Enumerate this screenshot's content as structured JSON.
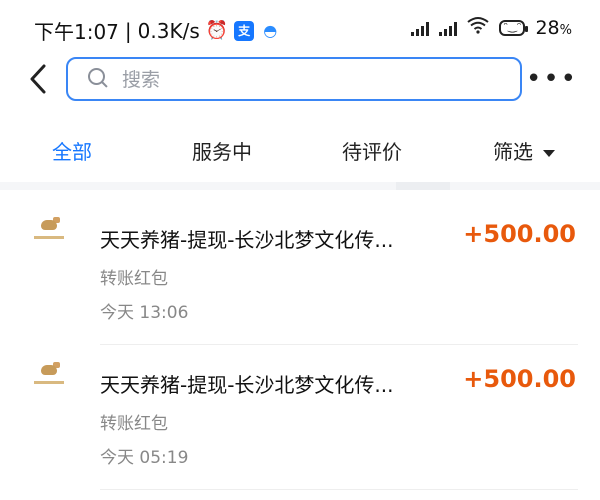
{
  "status_bar": {
    "time": "下午1:07",
    "speed": "0.3K/s",
    "alarm_icon": "alarm-clock-icon",
    "app_icons": [
      "alipay-icon",
      "wave-app-icon"
    ],
    "battery_level": "28",
    "battery_unit": "%"
  },
  "header": {
    "back_icon": "back-arrow-icon",
    "search_placeholder": "搜索",
    "search_value": "",
    "more_icon": "more-dots-icon"
  },
  "tabs": [
    {
      "label": "全部",
      "active": true
    },
    {
      "label": "服务中",
      "active": false
    },
    {
      "label": "待评价",
      "active": false
    },
    {
      "label": "筛选",
      "active": false
    }
  ],
  "transactions": [
    {
      "title": "天天养猪-提现-长沙北梦文化传...",
      "amount": "+500.00",
      "type": "转账红包",
      "time": "今天  13:06"
    },
    {
      "title": "天天养猪-提现-长沙北梦文化传...",
      "amount": "+500.00",
      "type": "转账红包",
      "time": "今天  05:19"
    }
  ],
  "colors": {
    "accent": "#1677ff",
    "amount": "#e8590c",
    "muted": "#888888"
  }
}
